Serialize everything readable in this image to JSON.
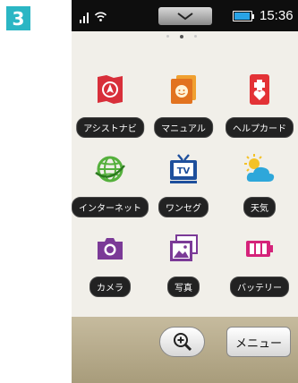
{
  "step": "3",
  "status_bar": {
    "time": "15:36",
    "icons": [
      "signal-icon",
      "wifi-icon",
      "notification-pull-tab",
      "battery-icon"
    ]
  },
  "page_indicator": {
    "count": 3,
    "active_index": 1
  },
  "apps": [
    {
      "label": "アシストナビ",
      "icon": "navigation-icon",
      "color": "#d82f3a"
    },
    {
      "label": "マニュアル",
      "icon": "manual-icon",
      "color": "#e2731f"
    },
    {
      "label": "ヘルプカード",
      "icon": "help-card-icon",
      "color": "#e33236"
    },
    {
      "label": "インターネット",
      "icon": "internet-globe-icon",
      "color": "#55b03c"
    },
    {
      "label": "ワンセグ",
      "icon": "tv-icon",
      "color": "#1e4f9c"
    },
    {
      "label": "天気",
      "icon": "weather-icon",
      "color": "#2ea7da"
    },
    {
      "label": "カメラ",
      "icon": "camera-icon",
      "color": "#7b3a97"
    },
    {
      "label": "写真",
      "icon": "photos-icon",
      "color": "#7b3a97"
    },
    {
      "label": "バッテリー",
      "icon": "battery-app-icon",
      "color": "#d5227a"
    }
  ],
  "dock": {
    "search_icon": "zoom-in-icon",
    "menu_label": "メニュー"
  }
}
